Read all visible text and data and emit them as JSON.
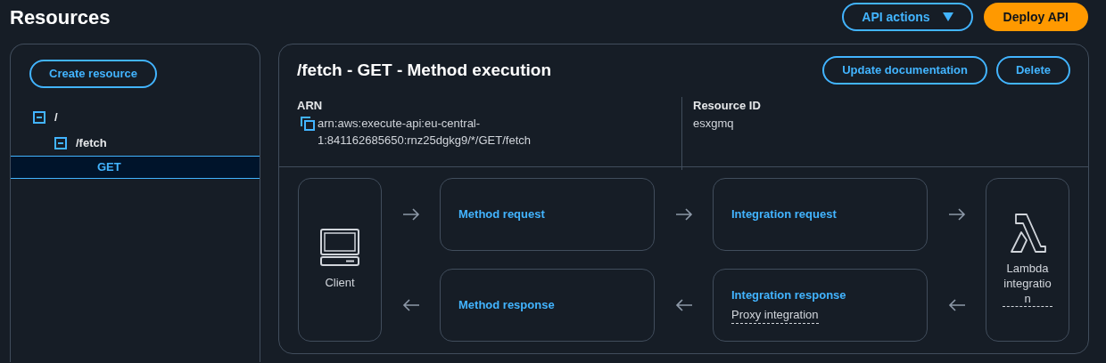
{
  "header": {
    "title": "Resources",
    "actions": [
      {
        "label": "API actions",
        "kind": "dropdown"
      },
      {
        "label": "Deploy API",
        "kind": "primary"
      }
    ]
  },
  "sidebar": {
    "create_button": "Create resource",
    "tree": [
      {
        "label": "/",
        "expanded": true,
        "selected": false,
        "children": [
          {
            "label": "/fetch",
            "expanded": true,
            "selected": false,
            "children": [
              {
                "label": "GET",
                "selected": true
              }
            ]
          }
        ]
      }
    ]
  },
  "method": {
    "title": "/fetch - GET - Method execution",
    "buttons": [
      "Update documentation",
      "Delete"
    ],
    "details": [
      {
        "label": "ARN",
        "value": "arn:aws:execute-api:eu-central-1:841162685650:rnz25dgkg9/*/GET/fetch",
        "copyable": true
      },
      {
        "label": "Resource ID",
        "value": "esxgmq",
        "copyable": false
      }
    ],
    "flow": {
      "client": "Client",
      "method_request": "Method request",
      "integration_request": "Integration request",
      "method_response": "Method response",
      "integration_response": {
        "title": "Integration response",
        "subtitle": "Proxy integration"
      },
      "backend": "Lambda integration"
    }
  }
}
